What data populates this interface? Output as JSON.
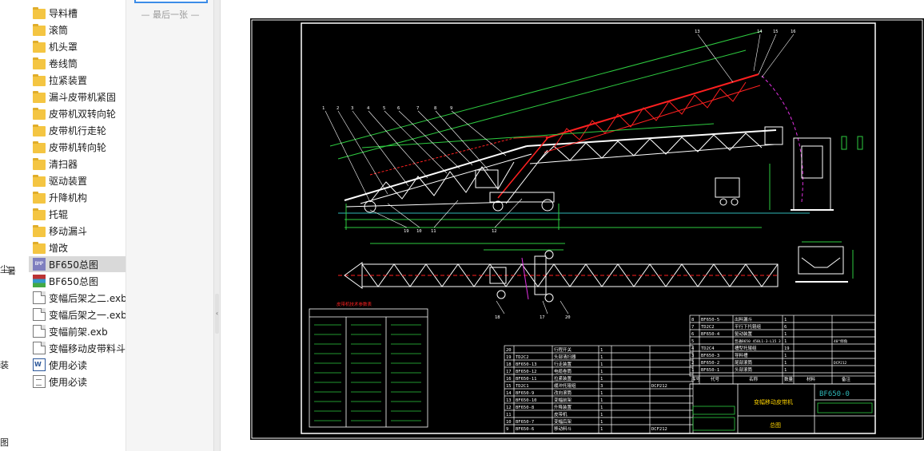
{
  "stub_fragments": [
    "尘",
    "暑",
    "装",
    "图"
  ],
  "files": [
    {
      "name": "导料槽",
      "type": "folder"
    },
    {
      "name": "滚筒",
      "type": "folder"
    },
    {
      "name": "机头罩",
      "type": "folder"
    },
    {
      "name": "卷线筒",
      "type": "folder"
    },
    {
      "name": "拉紧装置",
      "type": "folder"
    },
    {
      "name": "漏斗皮带机紧固",
      "type": "folder"
    },
    {
      "name": "皮带机双转向轮",
      "type": "folder"
    },
    {
      "name": "皮带机行走轮",
      "type": "folder"
    },
    {
      "name": "皮带机转向轮",
      "type": "folder"
    },
    {
      "name": "清扫器",
      "type": "folder"
    },
    {
      "name": "驱动装置",
      "type": "folder"
    },
    {
      "name": "升降机构",
      "type": "folder"
    },
    {
      "name": "托辊",
      "type": "folder"
    },
    {
      "name": "移动漏斗",
      "type": "folder"
    },
    {
      "name": "增改",
      "type": "folder"
    },
    {
      "name": "BF650总图",
      "type": "bmp",
      "selected": true
    },
    {
      "name": "BF650总图",
      "type": "archive"
    },
    {
      "name": "变幅后架之二.exb",
      "type": "file"
    },
    {
      "name": "变幅后架之一.exb",
      "type": "file"
    },
    {
      "name": "变幅前架.exb",
      "type": "file"
    },
    {
      "name": "变幅移动皮带料斗",
      "type": "file"
    },
    {
      "name": "使用必读",
      "type": "doc"
    },
    {
      "name": "使用必读",
      "type": "txt"
    }
  ],
  "bmp_icon_text": "BMP",
  "thumbnails": {
    "last_label": "— 最后一张 —"
  },
  "drawing": {
    "part_numbers_top": [
      "1",
      "2",
      "3",
      "4",
      "5",
      "6",
      "7",
      "8",
      "9",
      "13",
      "14",
      "15",
      "16"
    ],
    "part_numbers_bottom": [
      "19",
      "10",
      "11",
      "12"
    ],
    "part_numbers_plan": [
      "18",
      "17",
      "20"
    ],
    "title_drawing_number": "BF650-0",
    "title_name": "变幅移动皮带机",
    "title_sheet": "总图",
    "bom_upper": [
      [
        "8",
        "BF650-5",
        "出料漏斗",
        "1"
      ],
      [
        "7",
        "TD2C2",
        "平行下托辊组",
        "6"
      ],
      [
        "6",
        "BF650-4",
        "驱动装置",
        "1"
      ],
      [
        "5",
        "",
        "普通B650 450L1-3·L15 3",
        "1"
      ],
      [
        "4",
        "TD2C4",
        "槽型托辊组",
        "19"
      ],
      [
        "3",
        "BF650-3",
        "导料槽",
        "1"
      ],
      [
        "2",
        "BF650-2",
        "尾部滚筒",
        "1"
      ],
      [
        "1",
        "BF650-1",
        "头部滚筒",
        "1"
      ]
    ],
    "bom_lower": [
      [
        "20",
        "",
        "行程开关",
        "1"
      ],
      [
        "19",
        "TD2C2",
        "头部清扫器",
        "1"
      ],
      [
        "18",
        "BF650-13",
        "行走装置",
        "1"
      ],
      [
        "17",
        "BF650-12",
        "电缆卷筒",
        "1"
      ],
      [
        "16",
        "BF650-11",
        "拉紧装置",
        "1"
      ],
      [
        "15",
        "TD2C1",
        "缓冲托辊组",
        "3"
      ],
      [
        "14",
        "BF650-9",
        "改向滚筒",
        "1"
      ],
      [
        "13",
        "BF650-10",
        "变幅前架",
        "1"
      ],
      [
        "12",
        "BF650-8",
        "升降装置",
        "1"
      ],
      [
        "11",
        "",
        "皮带机",
        "1"
      ],
      [
        "10",
        "BF650-7",
        "变幅后架",
        "1"
      ],
      [
        "9",
        "BF650-6",
        "移动料斗",
        "1"
      ]
    ],
    "bom_header": [
      "序号",
      "代号",
      "名称",
      "数量",
      "材料",
      "备注"
    ],
    "notes_title": "皮带机技术参数表",
    "side_notes": [
      "DCP212",
      "40°倾角",
      "DCF212"
    ]
  }
}
